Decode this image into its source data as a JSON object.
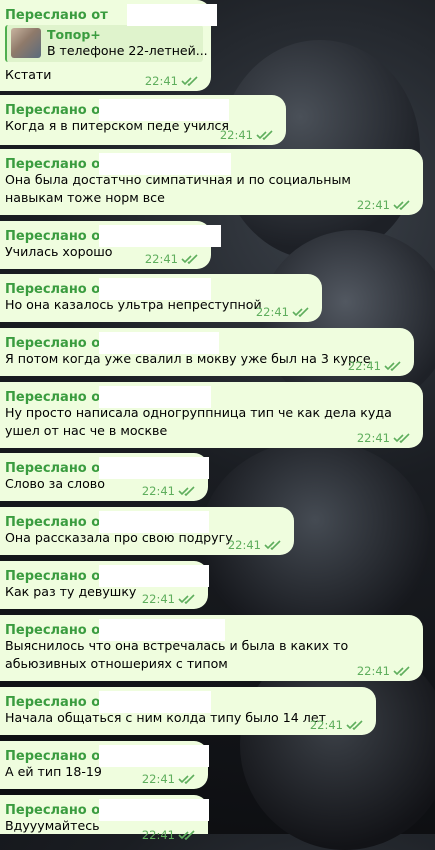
{
  "chat": {
    "forward_label": "Переслано от",
    "messages": [
      {
        "text": "Кстати",
        "time": "22:41",
        "quote": {
          "title": "Топор+",
          "text": "В телефоне 22-летней..."
        }
      },
      {
        "text": "Когда я в питерском педе учился",
        "time": "22:41"
      },
      {
        "text": "Она была достатчно симпатичная и по социальным навыкам тоже норм все",
        "time": "22:41"
      },
      {
        "text": "Училась хорошо",
        "time": "22:41"
      },
      {
        "text": "Но она казалось ультра непреступной",
        "time": "22:41"
      },
      {
        "text": "Я потом когда уже свалил в мокву уже был на 3 курсе",
        "time": "22:41"
      },
      {
        "text": "Ну просто написала одногруппница тип че как дела куда ушел от нас че в москве",
        "time": "22:41"
      },
      {
        "text": "Слово за слово",
        "time": "22:41"
      },
      {
        "text": "Она рассказала про свою подругу",
        "time": "22:41"
      },
      {
        "text": "Как раз ту девушку",
        "time": "22:41"
      },
      {
        "text": "Выяснилось что она встречалась и была в каких то абьюзивных отношериях с типом",
        "time": "22:41"
      },
      {
        "text": "Начала общаться с ним колда типу было 14 лет",
        "time": "22:41"
      },
      {
        "text": "А ей тип 18-19",
        "time": "22:41"
      },
      {
        "text": "Вдууумайтесь",
        "time": "22:41"
      }
    ]
  }
}
